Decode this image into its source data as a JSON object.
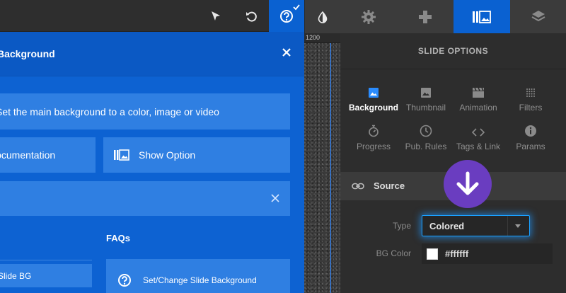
{
  "help_panel": {
    "title": "Background",
    "description": "Set the main background to a color, image or video",
    "documentation_label": "Documentation",
    "show_option_label": "Show Option",
    "faqs_heading": "FAQs",
    "topic_item": "Slide BG",
    "faq_item": "Set/Change Slide Background"
  },
  "canvas": {
    "ruler_label": "1200"
  },
  "slide_options": {
    "title": "SLIDE OPTIONS",
    "categories": [
      {
        "label": "Background",
        "icon": "image-icon",
        "active": true
      },
      {
        "label": "Thumbnail",
        "icon": "photo-icon",
        "active": false
      },
      {
        "label": "Animation",
        "icon": "film-icon",
        "active": false
      },
      {
        "label": "Filters",
        "icon": "dots-grid-icon",
        "active": false
      },
      {
        "label": "Progress",
        "icon": "stopwatch-icon",
        "active": false
      },
      {
        "label": "Pub. Rules",
        "icon": "clock-icon",
        "active": false
      },
      {
        "label": "Tags & Link",
        "icon": "code-icon",
        "active": false
      },
      {
        "label": "Params",
        "icon": "info-icon",
        "active": false
      }
    ],
    "source_label": "Source",
    "type_label": "Type",
    "type_value": "Colored",
    "bg_color_label": "BG Color",
    "bg_color_value": "#ffffff"
  },
  "colors": {
    "accent_blue": "#0a61d1",
    "help_panel_blue": "#0d62d2",
    "badge_purple": "#6a3dc0"
  }
}
